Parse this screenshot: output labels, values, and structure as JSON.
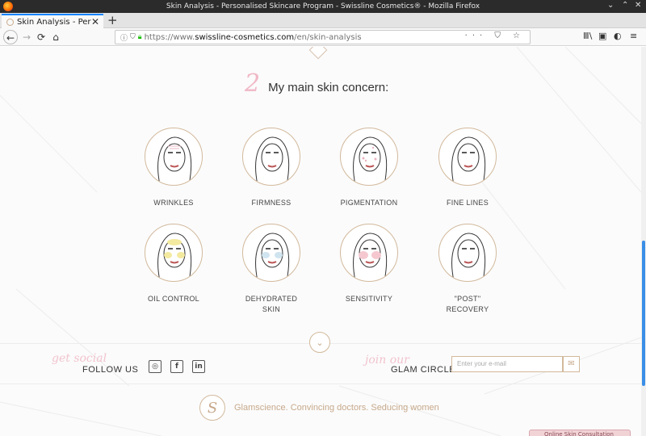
{
  "window": {
    "title": "Skin Analysis - Personalised Skincare Program - Swissline Cosmetics® - Mozilla Firefox",
    "controls": {
      "minimize": "⌄",
      "maximize": "⌃",
      "close": "✕"
    }
  },
  "tabs": [
    {
      "label": "Skin Analysis - Personalised Skincare Program",
      "close": "✕"
    }
  ],
  "new_tab": "+",
  "nav": {
    "back": "←",
    "forward": "→",
    "reload": "⟳",
    "home": "⌂"
  },
  "url": {
    "protocol": "https://www.",
    "domain": "swissline-cosmetics.com",
    "path": "/en/skin-analysis",
    "page_actions": "···  ⛉ ☆"
  },
  "toolbar_right": [
    "Ⅲ\\",
    "▣",
    "◐",
    "≡"
  ],
  "section": {
    "number": "2",
    "title": "My main skin concern:"
  },
  "options": [
    {
      "label_line1": "WRINKLES",
      "label_line2": ""
    },
    {
      "label_line1": "FIRMNESS",
      "label_line2": ""
    },
    {
      "label_line1": "PIGMENTATION",
      "label_line2": ""
    },
    {
      "label_line1": "FINE LINES",
      "label_line2": ""
    },
    {
      "label_line1": "OIL CONTROL",
      "label_line2": ""
    },
    {
      "label_line1": "DEHYDRATED",
      "label_line2": "SKIN"
    },
    {
      "label_line1": "SENSITIVITY",
      "label_line2": ""
    },
    {
      "label_line1": "\"POST\"",
      "label_line2": "RECOVERY"
    }
  ],
  "scroll_chevron": "⌄",
  "footer": {
    "get_social_script": "get social",
    "follow_label": "FOLLOW US",
    "social_icons": [
      "◎",
      "f",
      "in"
    ],
    "join_script": "join our",
    "glam_label": "GLAM CIRCLE",
    "email_placeholder": "Enter your e-mail",
    "email_button": "✉",
    "brand_mark": "S",
    "tagline": "Glamscience. Convincing doctors. Seducing women",
    "chat_label": "Online Skin Consultation"
  },
  "colors": {
    "gold": "#c7a98b",
    "pink_script": "#f0b8c6",
    "text": "#333333"
  }
}
